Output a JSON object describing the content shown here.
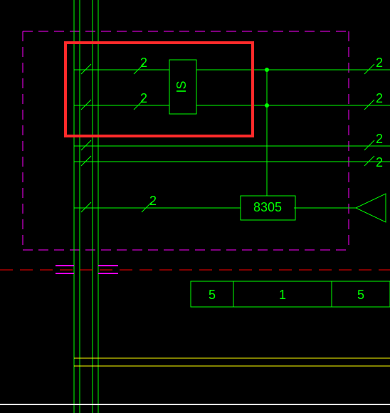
{
  "labels": {
    "wire_top_left_1": "2",
    "wire_top_left_2": "2",
    "wire_top_right_1": "2",
    "wire_right_2": "2",
    "wire_right_3": "2",
    "wire_right_4": "2",
    "wire_bottom_left": "2",
    "block_top_rotated": "IS",
    "block_mid": "8305",
    "table_cell_1": "5",
    "table_cell_2": "1",
    "table_cell_3": "5"
  }
}
